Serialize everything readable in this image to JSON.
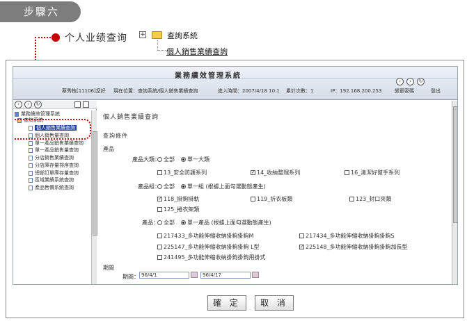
{
  "step": {
    "label": "步驟六"
  },
  "callout": {
    "text": "个人业绩查询"
  },
  "tree": {
    "root": "查詢系統",
    "child": "個人銷售業績查詢"
  },
  "app": {
    "title": "業務績效管理系統",
    "user": "蔡秀枝[11106]您好",
    "location": "現在位置：查詢系統/個人銷售業績查詢",
    "login_time": "進入時間：2007/4/18 10:1",
    "login_count": "累計次數：1",
    "ip": "IP：192.168.200.253",
    "change_password": "變更密碼",
    "logout": "登出"
  },
  "left_nav": {
    "root": "業務績效管理系統",
    "folder": "查詢系統",
    "items": [
      "個人銷售業績查詢",
      "個人銷售量查詢",
      "單一產品銷售業績查詢",
      "單一產品銷售量查詢",
      "分店銷售業績查詢",
      "分店庫存量排序查詢",
      "總部訂單庫存量查詢",
      "區域業績系統查詢",
      "產品售價系統查詢"
    ]
  },
  "content": {
    "heading": "個人銷售業績查詢",
    "condition_label": "查詢條件",
    "product_section": "產品",
    "category_label": "產品大類：",
    "category_all": "全部",
    "category_single": "單一大類",
    "categories": [
      {
        "label": "13_安全防護系列",
        "checked": false
      },
      {
        "label": "14_收納整理系列",
        "checked": true
      },
      {
        "label": "16_清潔好幫手系列",
        "checked": false
      }
    ],
    "group_label": "產品組：",
    "group_all": "全部",
    "group_single": "單一組 (根據上面勾選動態產生)",
    "groups": [
      {
        "label": "118_掛鉤掛軌",
        "checked": true
      },
      {
        "label": "119_折衣板類",
        "checked": false
      },
      {
        "label": "123_封口夾類",
        "checked": false
      },
      {
        "label": "125_捲衣架類",
        "checked": false
      }
    ],
    "item_label": "產品：",
    "item_all": "全部",
    "item_single": "單一產品 (根據上面勾選動態產生)",
    "items": [
      {
        "label": "217433_多功能伸縮收納掛鉤掛鉤M",
        "checked": false
      },
      {
        "label": "217434_多功能伸縮收納掛鉤掛鉤S",
        "checked": false
      },
      {
        "label": "225147_多功能伸縮收納掛鉤掛鉤 L型",
        "checked": false
      },
      {
        "label": "225148_多功能伸縮收納掛鉤掛鉤加長型",
        "checked": true
      },
      {
        "label": "241495_多功能伸縮收納掛鉤掛鉤用掛式",
        "checked": false
      }
    ],
    "period_section": "期間",
    "period_label": "期間：",
    "date_from": "96/4/1",
    "date_to": "96/4/17"
  },
  "buttons": {
    "confirm": "確 定",
    "cancel": "取 消"
  }
}
